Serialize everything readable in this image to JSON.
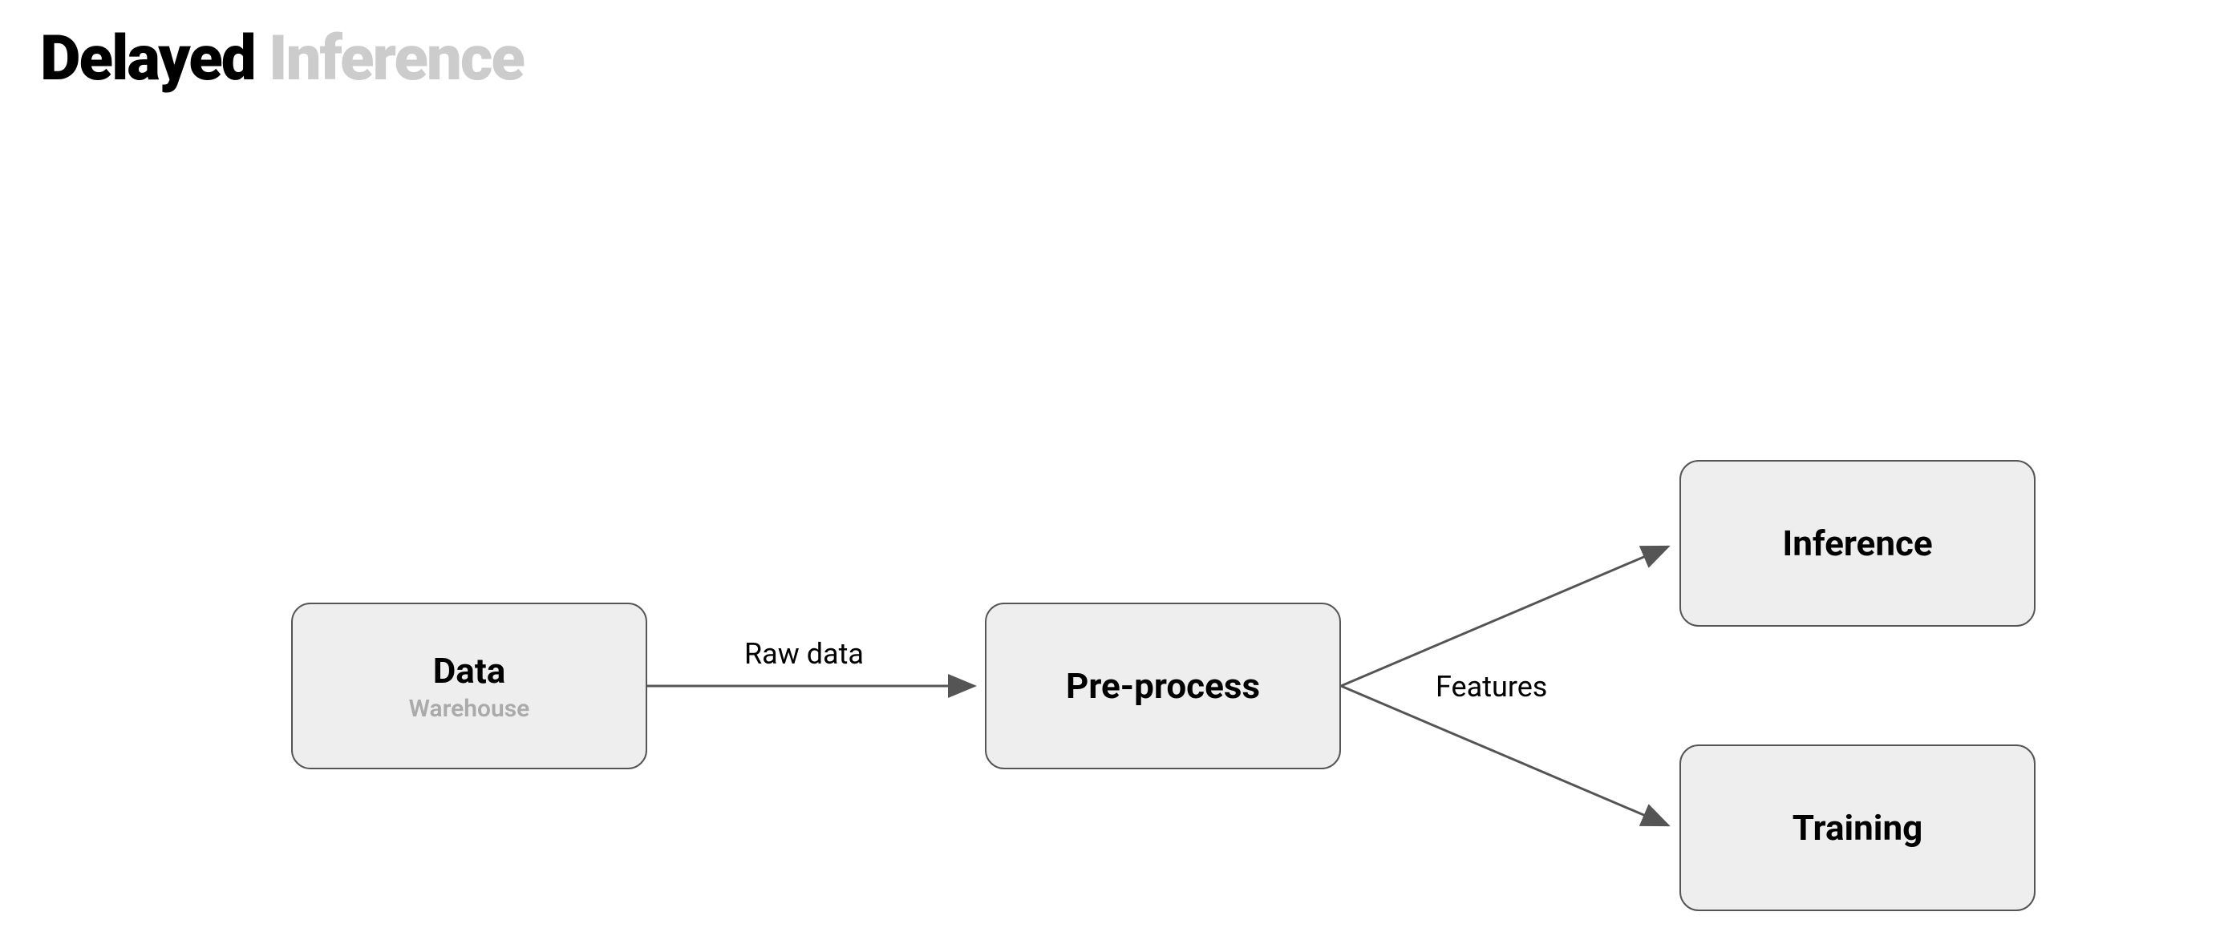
{
  "title": {
    "part1": "Delayed ",
    "part2": "Inference"
  },
  "nodes": {
    "data": {
      "title": "Data",
      "subtitle": "Warehouse"
    },
    "preprocess": {
      "title": "Pre-process"
    },
    "inference": {
      "title": "Inference"
    },
    "training": {
      "title": "Training"
    }
  },
  "edges": {
    "raw": {
      "label": "Raw data"
    },
    "features": {
      "label": "Features"
    }
  }
}
